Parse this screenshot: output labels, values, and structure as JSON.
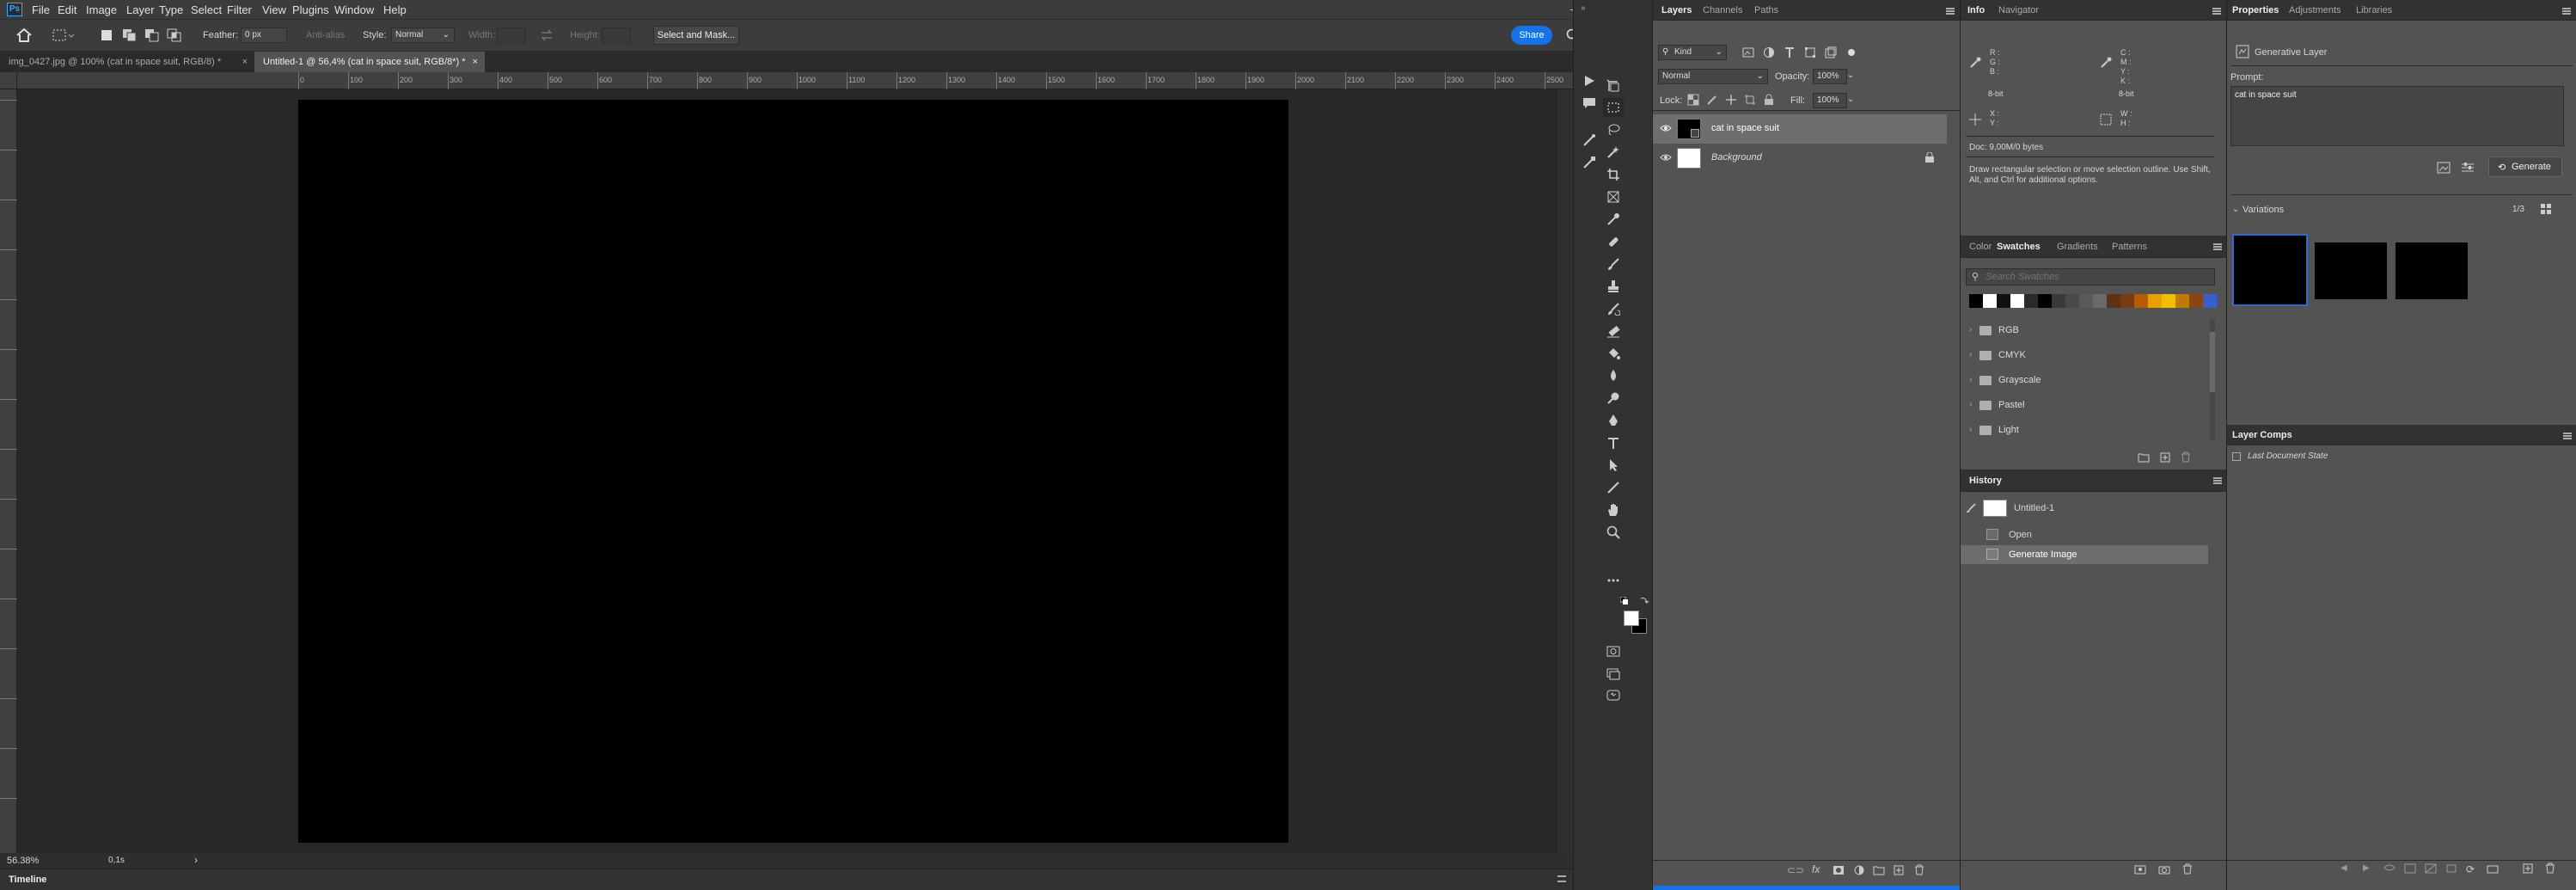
{
  "app": {
    "logo": "Ps",
    "window_controls": [
      "–",
      "❐",
      "✕"
    ]
  },
  "menu": [
    "File",
    "Edit",
    "Image",
    "Layer",
    "Type",
    "Select",
    "Filter",
    "View",
    "Plugins",
    "Window",
    "Help"
  ],
  "options": {
    "feather_label": "Feather:",
    "feather_value": "0 px",
    "antialias_label": "Anti-alias",
    "style_label": "Style:",
    "style_value": "Normal",
    "width_label": "Width:",
    "height_label": "Height:",
    "select_mask_label": "Select and Mask...",
    "share_label": "Share"
  },
  "tabs": [
    {
      "label": "img_0427.jpg @ 100% (cat in space suit, RGB/8) *",
      "close": "×"
    },
    {
      "label": "Untitled-1 @ 56,4% (cat in space suit, RGB/8*) *",
      "close": "×"
    }
  ],
  "ruler_ticks": [
    "0",
    "100",
    "200",
    "300",
    "400",
    "500",
    "600",
    "700",
    "800",
    "900",
    "1000",
    "1100",
    "1200",
    "1300",
    "1400",
    "1500",
    "1600",
    "1700",
    "1800",
    "1900",
    "2000",
    "2100",
    "2200",
    "2300",
    "2400",
    "2500"
  ],
  "status": {
    "zoom": "56.38%",
    "time": "0,1s",
    "arrow": "›"
  },
  "timeline": {
    "title": "Timeline"
  },
  "layers_panel": {
    "tabs": [
      "Layers",
      "Channels",
      "Paths"
    ],
    "kind": "Kind",
    "blend_mode": "Normal",
    "opacity_label": "Opacity:",
    "opacity_value": "100%",
    "lock_label": "Lock:",
    "fill_label": "Fill:",
    "fill_value": "100%",
    "layers": [
      {
        "name": "cat in space suit",
        "selected": true
      },
      {
        "name": "Background",
        "selected": false
      }
    ]
  },
  "info_panel": {
    "tabs": [
      "Info",
      "Navigator"
    ],
    "rgb": [
      "R :",
      "G :",
      "B :"
    ],
    "cmyk": [
      "C :",
      "M :",
      "Y :",
      "K :"
    ],
    "bit_left": "8-bit",
    "bit_right": "8-bit",
    "xy": [
      "X :",
      "Y :"
    ],
    "wh": [
      "W :",
      "H :"
    ],
    "doc": "Doc: 9,00M/0 bytes",
    "hint": "Draw rectangular selection or move selection outline.  Use Shift, Alt, and Ctrl for additional options."
  },
  "swatches_panel": {
    "tabs": [
      "Color",
      "Swatches",
      "Gradients",
      "Patterns"
    ],
    "search_placeholder": "Search Swatches",
    "colors": [
      "#000000",
      "#ffffff",
      "#111111",
      "#ffffff",
      "#2a2a2a",
      "#000000",
      "#3a3a3a",
      "#4a4a4a",
      "#5a5a5a",
      "#6a6a6a",
      "#5c3317",
      "#7a3b10",
      "#b85c00",
      "#e8a000",
      "#f0c000",
      "#c07a00",
      "#8b4513",
      "#3a5fcd"
    ],
    "folders": [
      "RGB",
      "CMYK",
      "Grayscale",
      "Pastel",
      "Light"
    ]
  },
  "history_panel": {
    "title": "History",
    "snapshot": "Untitled-1",
    "items": [
      "Open",
      "Generate Image"
    ]
  },
  "properties_panel": {
    "tabs": [
      "Properties",
      "Adjustments",
      "Libraries"
    ],
    "layer_type": "Generative Layer",
    "prompt_label": "Prompt:",
    "prompt_value": "cat in space suit",
    "generate_label": "Generate",
    "variations_label": "Variations",
    "variations_count": "1/3"
  },
  "layer_comps_panel": {
    "title": "Layer Comps",
    "item": "Last Document State"
  },
  "colors": {
    "accent": "#1473e6",
    "selection": "#2d6ad6"
  }
}
